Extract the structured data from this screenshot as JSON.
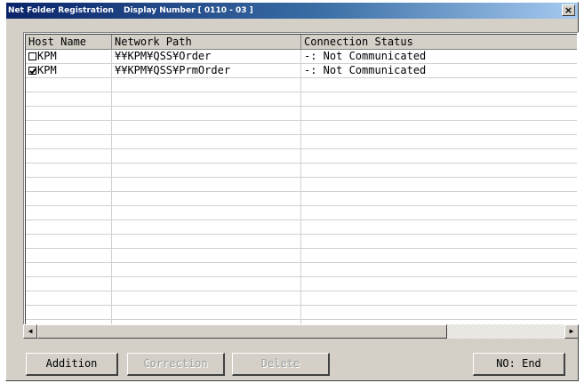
{
  "window": {
    "title": "Net Folder Registration",
    "display_number": "Display Number [ 0110 - 03 ]",
    "close_label": "×"
  },
  "table": {
    "columns": [
      "Host Name",
      "Network Path",
      "Connection Status"
    ],
    "rows": [
      {
        "checked": false,
        "host": "KPM",
        "path": "¥¥KPM¥QSS¥Order",
        "status": "-: Not Communicated"
      },
      {
        "checked": true,
        "host": "KPM",
        "path": "¥¥KPM¥QSS¥PrmOrder",
        "status": "-: Not Communicated"
      }
    ]
  },
  "scrollbar": {
    "left_arrow": "◀",
    "right_arrow": "▶"
  },
  "buttons": {
    "addition": "Addition",
    "correction": "Correction",
    "delete": "Delete",
    "end": "NO: End"
  }
}
